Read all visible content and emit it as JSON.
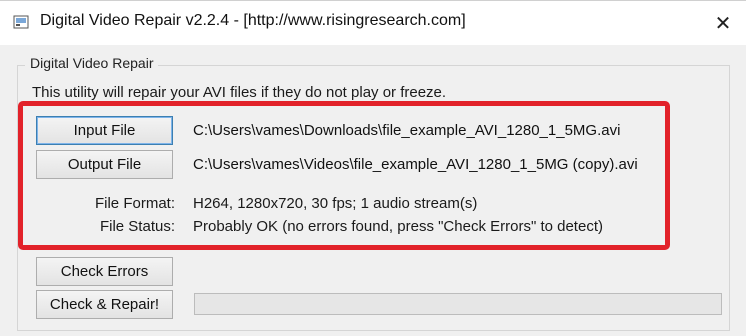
{
  "window": {
    "title": "Digital Video Repair v2.2.4 - [http://www.risingresearch.com]",
    "close_glyph": "✕"
  },
  "group": {
    "label": "Digital Video Repair",
    "description": "This utility will repair your AVI files if they do not play or freeze."
  },
  "input": {
    "button_label": "Input File",
    "path": "C:\\Users\\vames\\Downloads\\file_example_AVI_1280_1_5MG.avi"
  },
  "output": {
    "button_label": "Output File",
    "path": "C:\\Users\\vames\\Videos\\file_example_AVI_1280_1_5MG (copy).avi"
  },
  "info": {
    "format_label": "File Format:",
    "format_value": "H264, 1280x720, 30 fps; 1 audio stream(s)",
    "status_label": "File Status:",
    "status_value": "Probably OK (no errors found, press \"Check Errors\" to detect)"
  },
  "actions": {
    "check_errors_label": "Check Errors",
    "check_repair_label": "Check & Repair!"
  },
  "progress": {
    "value": 0
  },
  "colors": {
    "highlight": "#e2222a",
    "default_button_border": "#3c7fb1"
  },
  "icons": {
    "app": "app-icon",
    "close": "close-icon"
  }
}
